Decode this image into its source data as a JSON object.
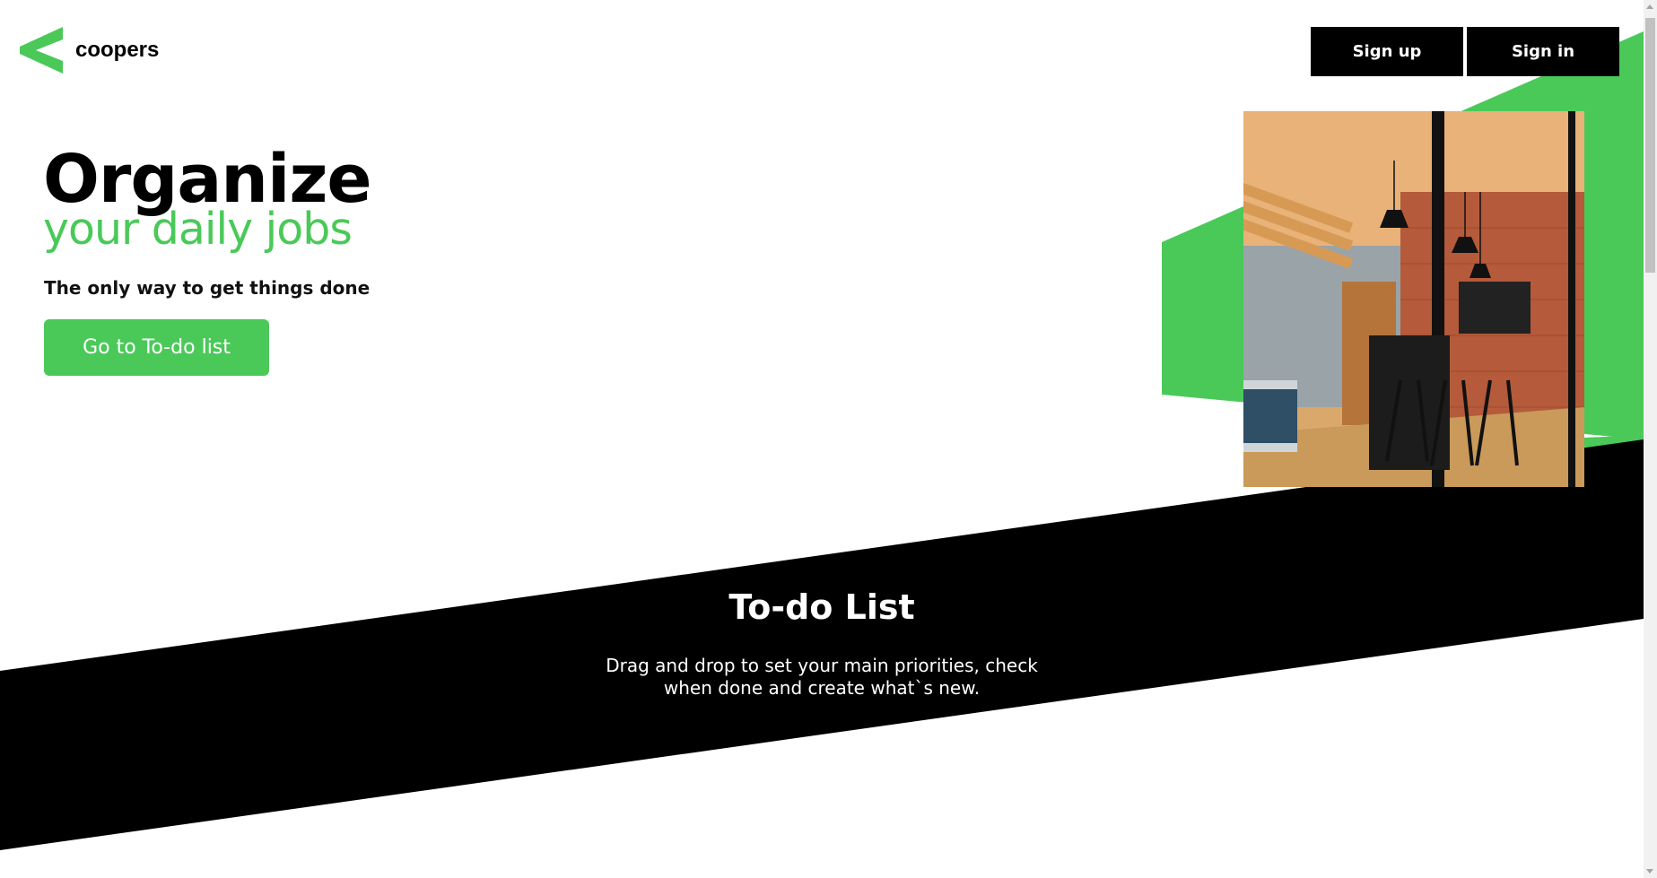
{
  "brand": {
    "name": "coopers",
    "accent": "#4ac959"
  },
  "header": {
    "signup_label": "Sign up",
    "signin_label": "Sign in"
  },
  "hero": {
    "title": "Organize",
    "subtitle": "your daily jobs",
    "tagline": "The only way to get things done",
    "cta_label": "Go to To-do list"
  },
  "todo": {
    "title": "To-do List",
    "desc_line1": "Drag and drop to set your main priorities, check",
    "desc_line2": "when done and create what`s new."
  }
}
